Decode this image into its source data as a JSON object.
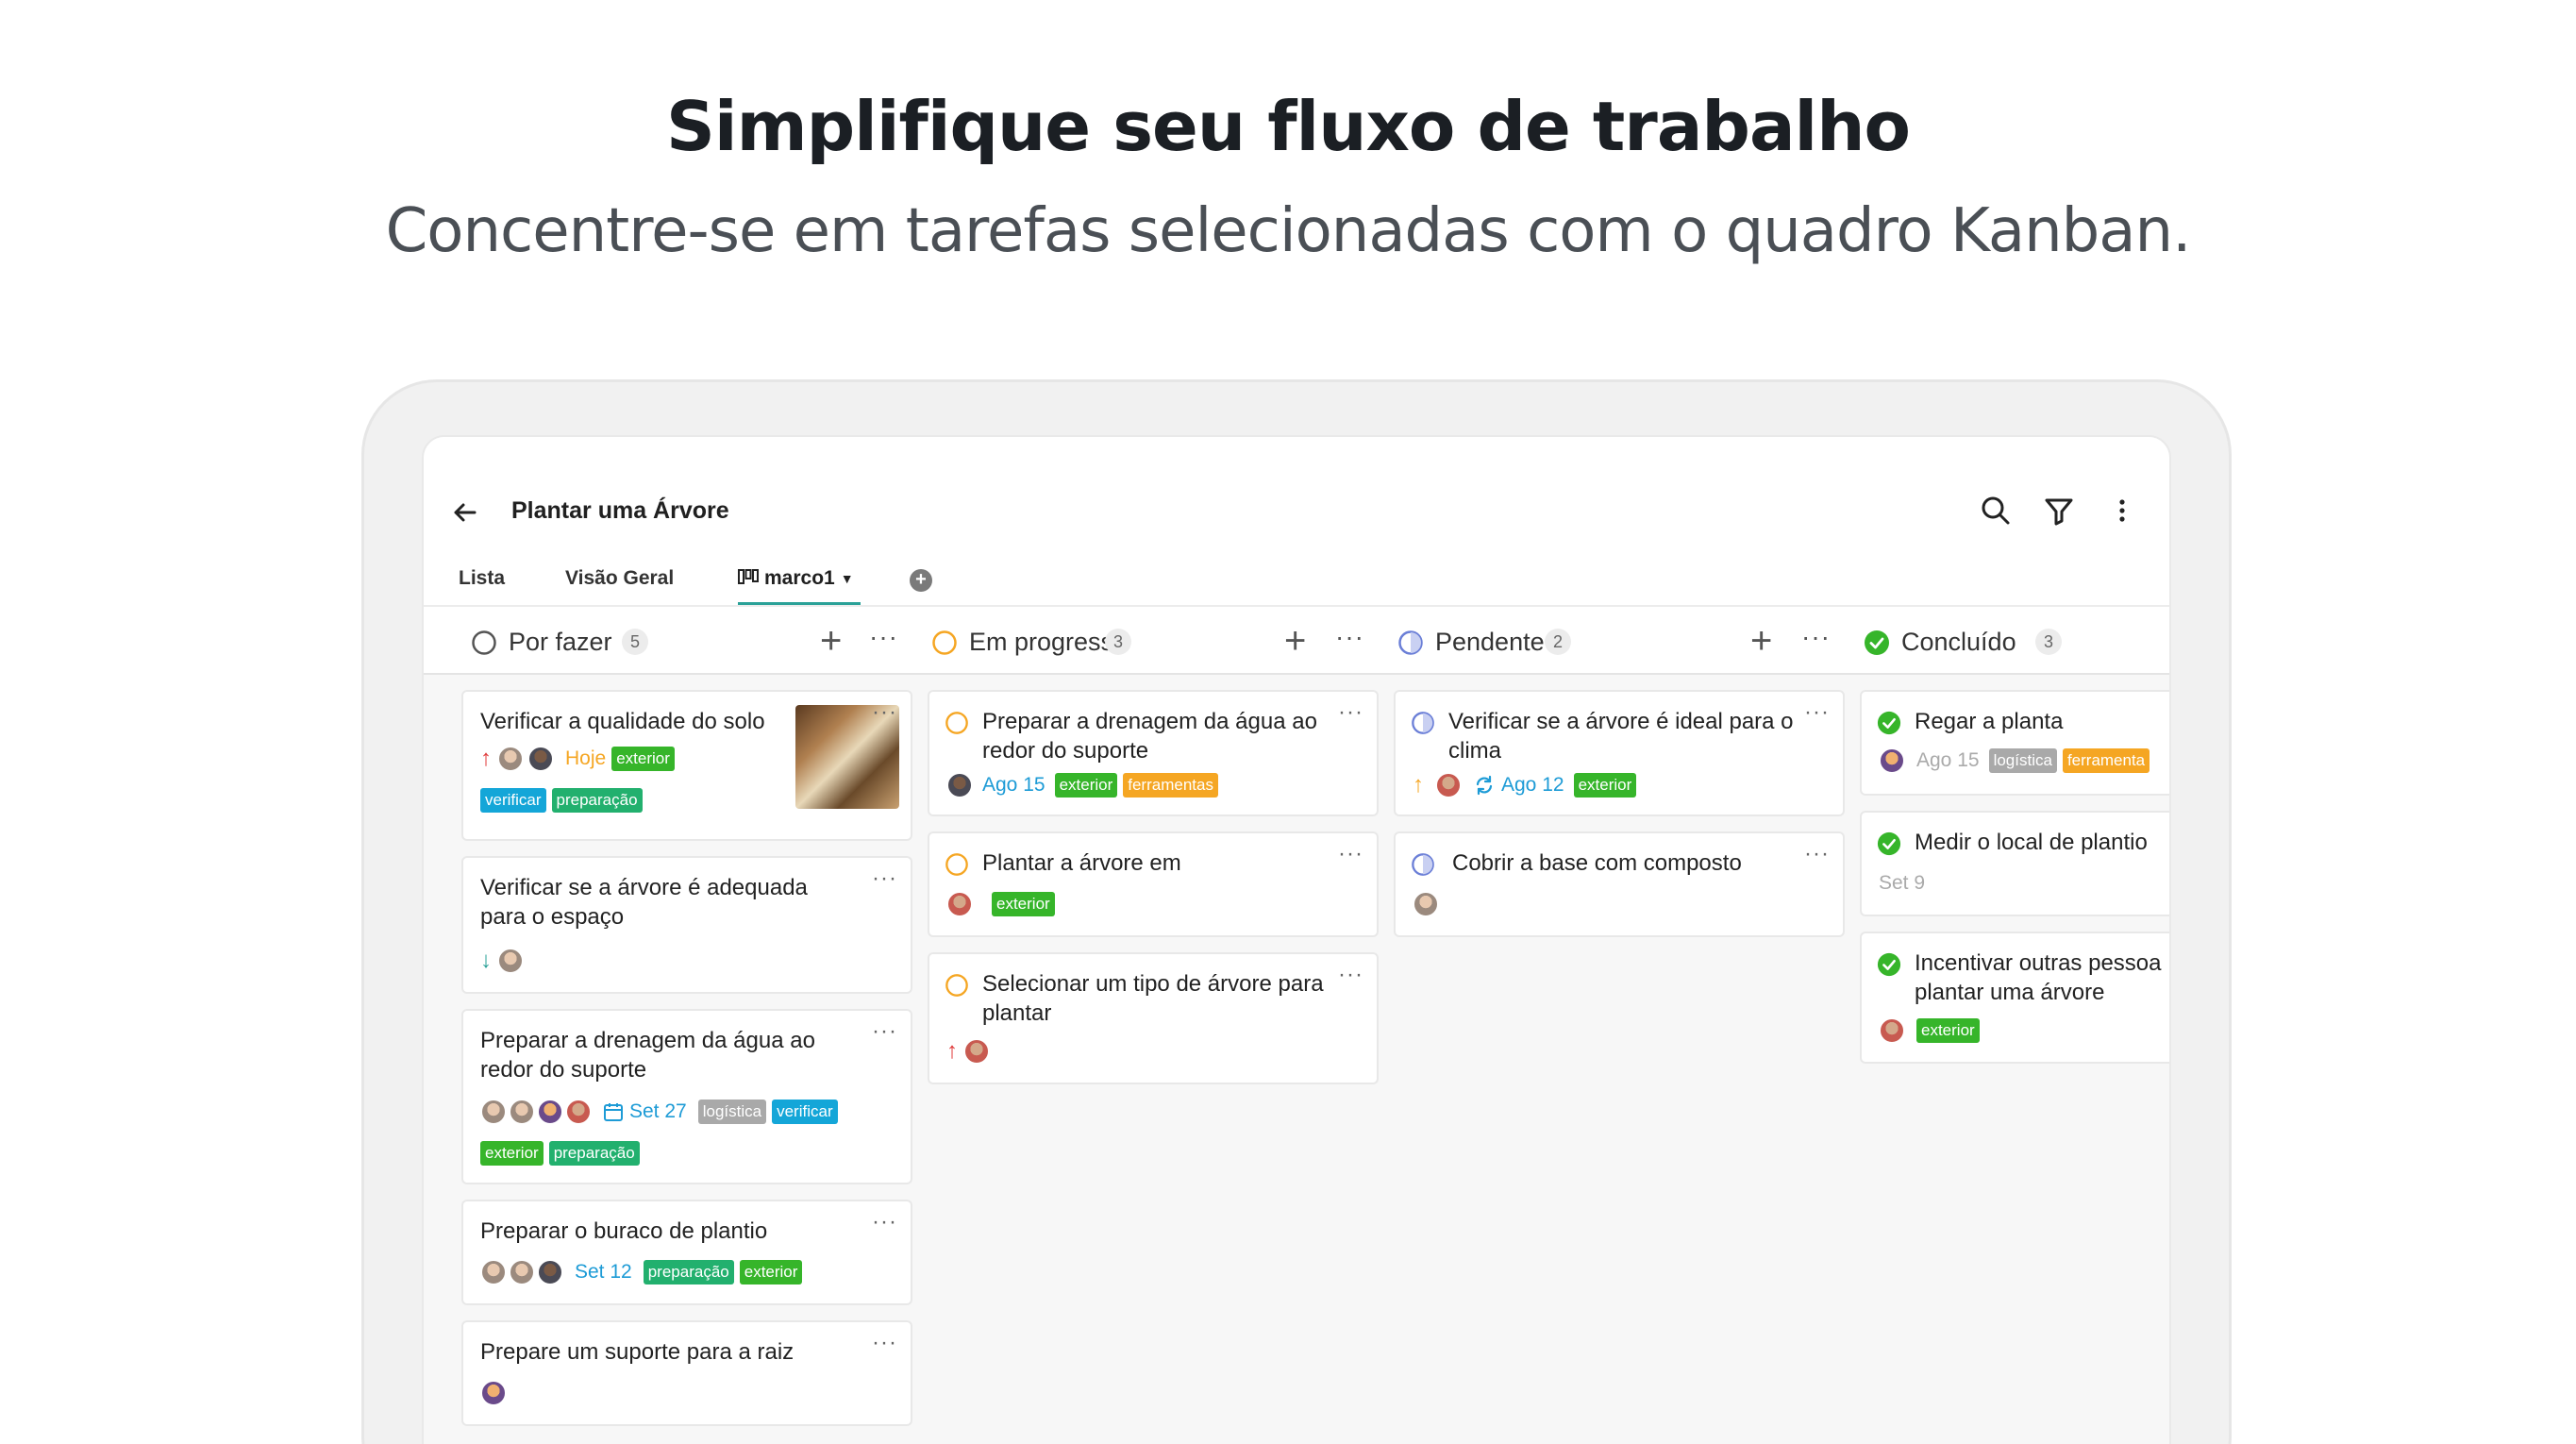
{
  "marketing": {
    "headline": "Simplifique seu fluxo de trabalho",
    "subline": "Concentre-se em tarefas selecionadas com o quadro Kanban."
  },
  "app": {
    "project_title": "Plantar uma Árvore",
    "icons": {
      "back": "arrow-left-icon",
      "search": "search-icon",
      "filter": "filter-icon",
      "more": "more-vertical-icon"
    },
    "tabs": [
      {
        "label": "Lista"
      },
      {
        "label": "Visão Geral"
      },
      {
        "label": "marco1"
      }
    ],
    "accent": "#2aa198"
  },
  "columns": [
    {
      "name": "Por fazer",
      "count": "5",
      "status_color": "#555555",
      "cards": [
        {
          "title": "Verificar a qualidade do solo",
          "date": "Hoje",
          "tags": [
            "exterior",
            "verificar",
            "preparação"
          ]
        },
        {
          "title": "Verificar se a árvore é adequada para o espaço"
        },
        {
          "title": "Preparar a drenagem da água ao redor do suporte",
          "date": "Set 27",
          "tags": [
            "logística",
            "verificar",
            "exterior",
            "preparação"
          ]
        },
        {
          "title": "Preparar o buraco de plantio",
          "date": "Set 12",
          "tags": [
            "preparação",
            "exterior"
          ]
        },
        {
          "title": "Prepare um suporte para a raiz"
        }
      ]
    },
    {
      "name": "Em progresso",
      "count": "3",
      "status_color": "#f5a623",
      "cards": [
        {
          "title": "Preparar a drenagem da água ao redor do suporte",
          "date": "Ago 15",
          "tags": [
            "exterior",
            "ferramentas"
          ]
        },
        {
          "title": "Plantar a árvore em",
          "tags": [
            "exterior"
          ]
        },
        {
          "title": "Selecionar um tipo de árvore para plantar"
        }
      ]
    },
    {
      "name": "Pendente",
      "count": "2",
      "status_color": "#6b7fd7",
      "cards": [
        {
          "title": "Verificar se a árvore é ideal para o clima",
          "date": "Ago 12",
          "tags": [
            "exterior"
          ]
        },
        {
          "title": "Cobrir a base com composto"
        }
      ]
    },
    {
      "name": "Concluído",
      "count": "3",
      "status_color": "#36b52a",
      "cards": [
        {
          "title": "Regar a planta",
          "date": "Ago 15",
          "tags": [
            "logística",
            "ferramenta"
          ]
        },
        {
          "title": "Medir o local de plantio",
          "date": "Set 9"
        },
        {
          "title": "Incentivar outras pessoa plantar uma árvore",
          "tags": [
            "exterior"
          ]
        }
      ]
    }
  ]
}
